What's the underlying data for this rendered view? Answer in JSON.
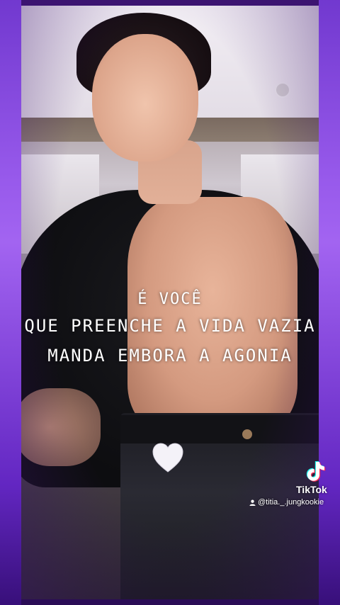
{
  "lyrics": {
    "line1": "É VOCÊ",
    "line2": "QUE PREENCHE A VIDA VAZIA",
    "line3": "MANDA EMBORA A AGONIA"
  },
  "overlay": {
    "heart_icon": "white-heart-icon",
    "brand": "TikTok",
    "handle": "@titia._.jungkookie"
  },
  "colors": {
    "frame_purple": "#5a22a8",
    "glow": "#b070ff",
    "text": "#ffffff"
  }
}
